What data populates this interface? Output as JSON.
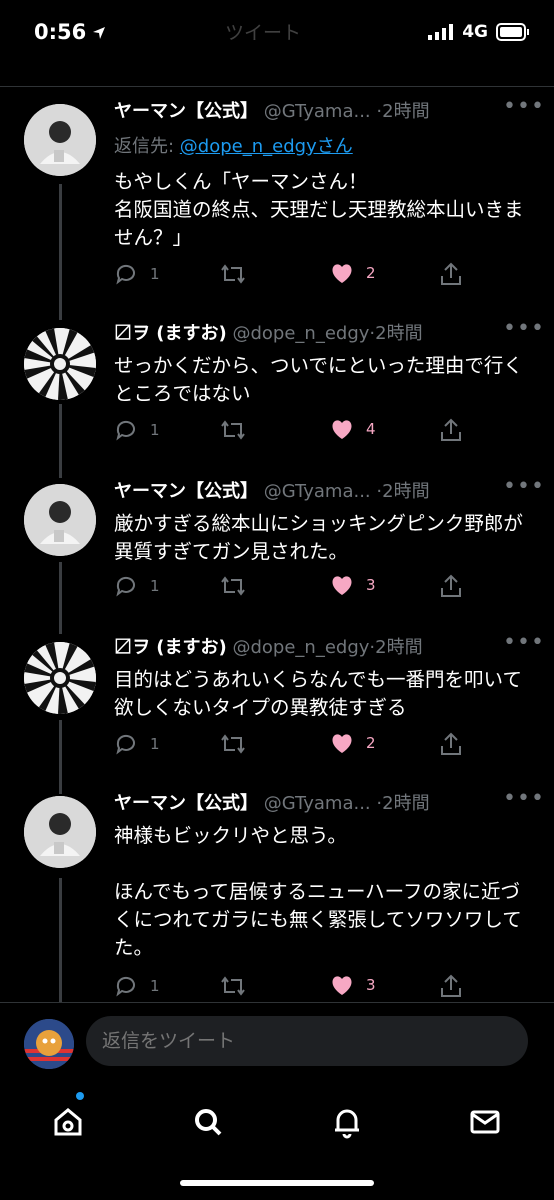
{
  "status": {
    "time": "0:56",
    "network": "4G"
  },
  "header": {
    "title": "ツイート"
  },
  "tweets": [
    {
      "name": "ヤーマン【公式】",
      "handle": "@GTyama...",
      "time": "·2時間",
      "reply_prefix": "返信先: ",
      "reply_to": "@dope_n_edgyさん",
      "text": "もやしくん「ヤーマンさん！\n名阪国道の終点、天理だし天理教総本山いきません？」",
      "replies": "1",
      "retweets": "",
      "likes": "2"
    },
    {
      "name": "〼ヲ (ますお)",
      "handle": "@dope_n_edgy",
      "time": "·2時間",
      "text": "せっかくだから、ついでにといった理由で行くところではない",
      "replies": "1",
      "retweets": "",
      "likes": "4"
    },
    {
      "name": "ヤーマン【公式】",
      "handle": "@GTyama...",
      "time": "·2時間",
      "text": "厳かすぎる総本山にショッキングピンク野郎が異質すぎてガン見された。",
      "replies": "1",
      "retweets": "",
      "likes": "3"
    },
    {
      "name": "〼ヲ (ますお)",
      "handle": "@dope_n_edgy",
      "time": "·2時間",
      "text": "目的はどうあれいくらなんでも一番門を叩いて欲しくないタイプの異教徒すぎる",
      "replies": "1",
      "retweets": "",
      "likes": "2"
    },
    {
      "name": "ヤーマン【公式】",
      "handle": "@GTyama...",
      "time": "·2時間",
      "text": "神様もビックリやと思う。\n\nほんでもって居候するニューハーフの家に近づくにつれてガラにも無く緊張してソワソワしてた。",
      "replies": "1",
      "retweets": "",
      "likes": "3"
    }
  ],
  "reply": {
    "placeholder": "返信をツイート"
  },
  "colors": {
    "link": "#1d9bf0",
    "like": "#f7a8c4",
    "muted": "#71767b"
  }
}
